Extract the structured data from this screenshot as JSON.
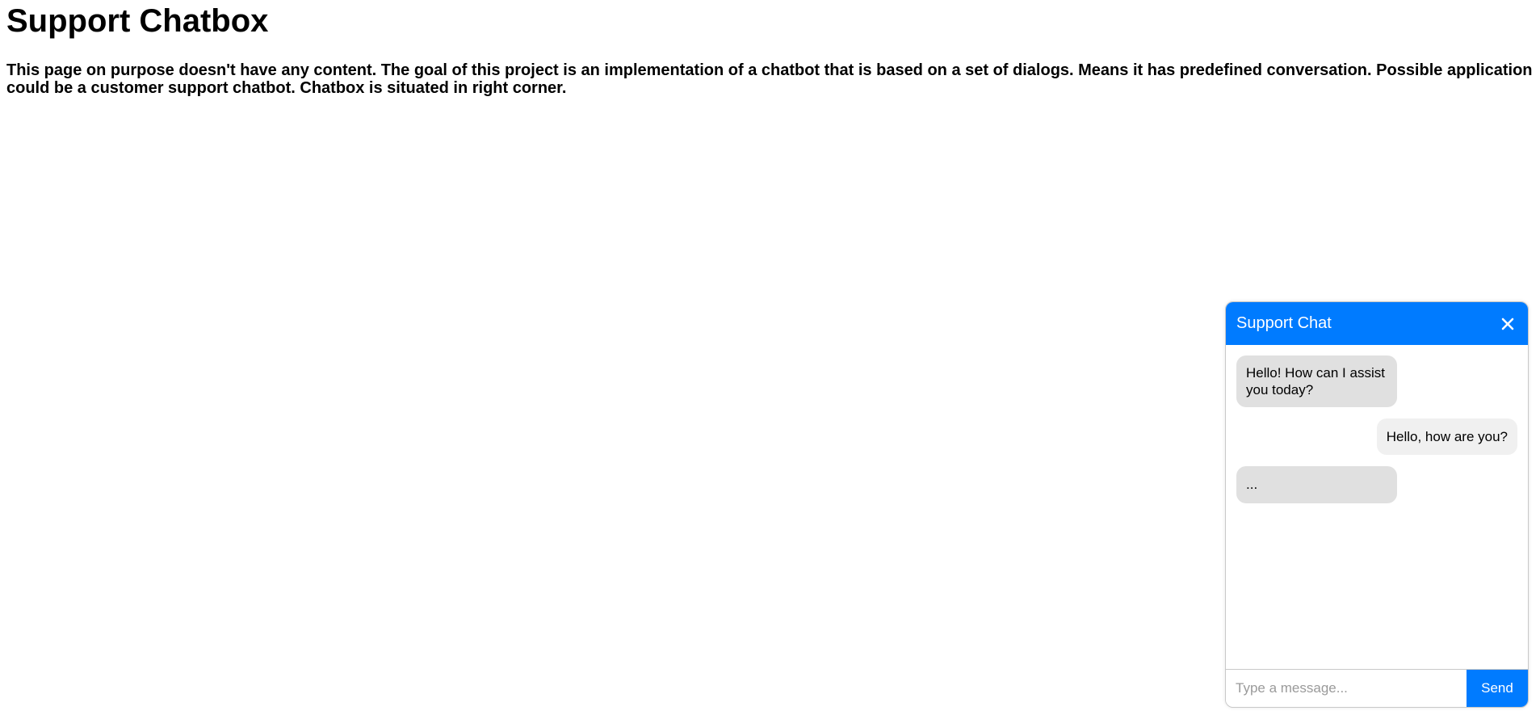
{
  "page": {
    "title": "Support Chatbox",
    "description": "This page on purpose doesn't have any content. The goal of this project is an implementation of a chatbot that is based on a set of dialogs. Means it has predefined conversation. Possible application could be a customer support chatbot. Chatbox is situated in right corner."
  },
  "chat": {
    "title": "Support Chat",
    "close_icon": "close-icon",
    "messages": [
      {
        "sender": "bot",
        "text": "Hello! How can I assist you today?"
      },
      {
        "sender": "user",
        "text": "Hello, how are you?"
      },
      {
        "sender": "bot",
        "text": "..."
      }
    ],
    "input": {
      "placeholder": "Type a message...",
      "value": ""
    },
    "send_label": "Send"
  },
  "colors": {
    "accent": "#007bff",
    "bot_bubble": "#e0e0e0",
    "user_bubble": "#f0f0f0",
    "background": "#ffffff"
  }
}
